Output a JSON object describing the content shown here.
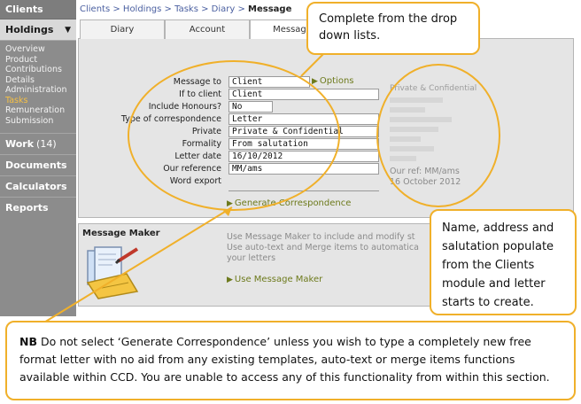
{
  "sidebar": {
    "clients": "Clients",
    "holdings": "Holdings",
    "holdings_arrow": "▼",
    "menu": [
      "Overview",
      "Product",
      "Contributions",
      "Details",
      "Administration",
      "Tasks",
      "Remuneration",
      "Submission"
    ],
    "active_menu_index": 5,
    "work": "Work",
    "work_count": "(14)",
    "documents": "Documents",
    "calculators": "Calculators",
    "reports": "Reports"
  },
  "breadcrumb": {
    "clients": "Clients",
    "holdings": "Holdings",
    "tasks": "Tasks",
    "diary": "Diary",
    "sep": " > ",
    "current": "Message"
  },
  "tabs": [
    "Diary",
    "Account",
    "Message"
  ],
  "form": {
    "labels": [
      "Message to",
      "If to client",
      "Include Honours?",
      "Type of correspondence",
      "Private",
      "Formality",
      "Letter date",
      "Our reference",
      "Word export"
    ],
    "message_to": "Client",
    "if_to_client": "Client",
    "include_honours": "No",
    "type_of_correspondence": "Letter",
    "private": "Private & Confidential",
    "formality": "From salutation",
    "letter_date": "16/10/2012",
    "our_reference": "MM/ams",
    "options": "Options",
    "generate": "Generate Correspondence"
  },
  "preview": {
    "title": "Private & Confidential",
    "our_ref": "Our ref: MM/ams",
    "date": "16 October 2012"
  },
  "message_maker": {
    "title": "Message Maker",
    "line1": "Use Message Maker to include and modify st",
    "line2": "Use auto-text and Merge items to automatica",
    "line3": "your letters",
    "link": "Use Message Maker"
  },
  "callouts": {
    "top": "Complete from the drop down lists.",
    "right": "Name, address and salutation populate from the Clients module and letter starts to create.",
    "nb_bold": "NB",
    "nb_text": " Do not select ‘Generate Correspondence’ unless you wish to type a completely new free format letter with no aid from any existing templates, auto-text or merge items functions available within CCD. You are unable to access any of this functionality from within this section."
  },
  "colors": {
    "annotation": "#f0b02a",
    "link_green": "#6d7a1c",
    "sidebar": "#8c8c8c"
  }
}
